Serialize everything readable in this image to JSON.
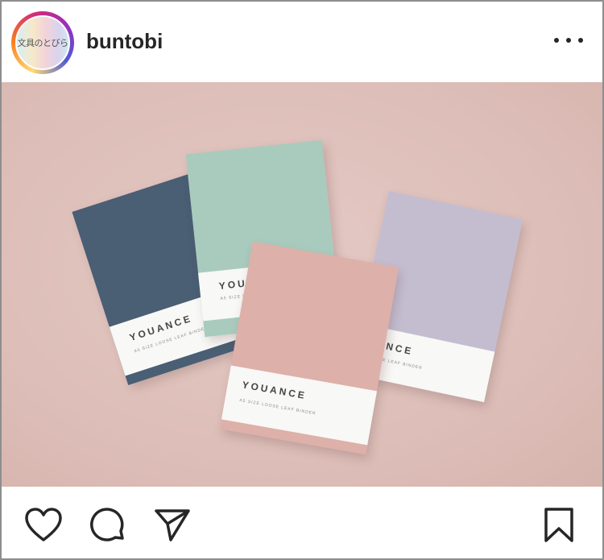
{
  "post": {
    "avatar_text": "文具のとびら",
    "username": "buntobi"
  },
  "photo": {
    "description_icon": "photo-image",
    "binders": [
      {
        "brand": "YOUANCE",
        "sub": "A5 SIZE LOOSE LEAF BINDER",
        "color": "#4a5e74"
      },
      {
        "brand": "YOUANCE",
        "sub": "A5 SIZE LOOSE LEAF BINDER",
        "color": "#a9cbbd"
      },
      {
        "brand": "YOUANCE",
        "sub": "A5 SIZE LOOSE LEAF BINDER",
        "color": "#c4bdd0"
      },
      {
        "brand": "YOUANCE",
        "sub": "A5 SIZE LOOSE LEAF BINDER",
        "color": "#deb0aa"
      }
    ]
  },
  "actions": {
    "like": "heart-icon",
    "comment": "comment-icon",
    "share": "send-icon",
    "save": "bookmark-icon"
  },
  "colors": {
    "text": "#262626",
    "background": "#d9bcb6"
  }
}
